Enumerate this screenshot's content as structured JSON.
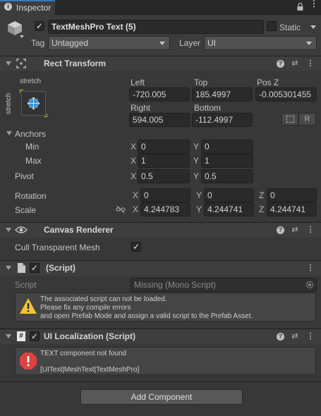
{
  "tab": {
    "title": "Inspector"
  },
  "gameobject": {
    "name": "TextMeshPro Text (5)",
    "static_label": "Static",
    "tag_label": "Tag",
    "tag_value": "Untagged",
    "layer_label": "Layer",
    "layer_value": "UI"
  },
  "rect_transform": {
    "title": "Rect Transform",
    "anchor_preset_h": "stretch",
    "anchor_preset_v": "stretch",
    "left_label": "Left",
    "left_value": "-720.005",
    "top_label": "Top",
    "top_value": "185.4997",
    "posz_label": "Pos Z",
    "posz_value": "-0.005301455",
    "right_label": "Right",
    "right_value": "594.005",
    "bottom_label": "Bottom",
    "bottom_value": "-112.4997",
    "r_button": "R",
    "anchors_label": "Anchors",
    "min_label": "Min",
    "min_x": "0",
    "min_y": "0",
    "max_label": "Max",
    "max_x": "1",
    "max_y": "1",
    "pivot_label": "Pivot",
    "pivot_x": "0.5",
    "pivot_y": "0.5",
    "rotation_label": "Rotation",
    "rot_x": "0",
    "rot_y": "0",
    "rot_z": "0",
    "scale_label": "Scale",
    "scale_x": "4.244783",
    "scale_y": "4.244741",
    "scale_z": "4.244741",
    "axis_x": "X",
    "axis_y": "Y",
    "axis_z": "Z"
  },
  "canvas_renderer": {
    "title": "Canvas Renderer",
    "cull_label": "Cull Transparent Mesh",
    "cull_checked": true
  },
  "missing_script": {
    "title": "(Script)",
    "script_label": "Script",
    "script_value": "Missing (Mono Script)",
    "warning_line1": "The associated script can not be loaded.",
    "warning_line2": "Please fix any compile errors",
    "warning_line3": "and open Prefab Mode and assign a valid script to the Prefab Asset."
  },
  "ui_localization": {
    "title": "UI Localization (Script)",
    "error_line1": "TEXT component not found",
    "error_line2": "[UIText|MeshText|TextMeshPro]"
  },
  "add_component": {
    "label": "Add Component"
  },
  "colors": {
    "panel_bg": "#383838",
    "header_bg": "#3e3e3e",
    "field_bg": "#2a2a2a",
    "warning": "#f2c232",
    "error": "#e04040"
  }
}
